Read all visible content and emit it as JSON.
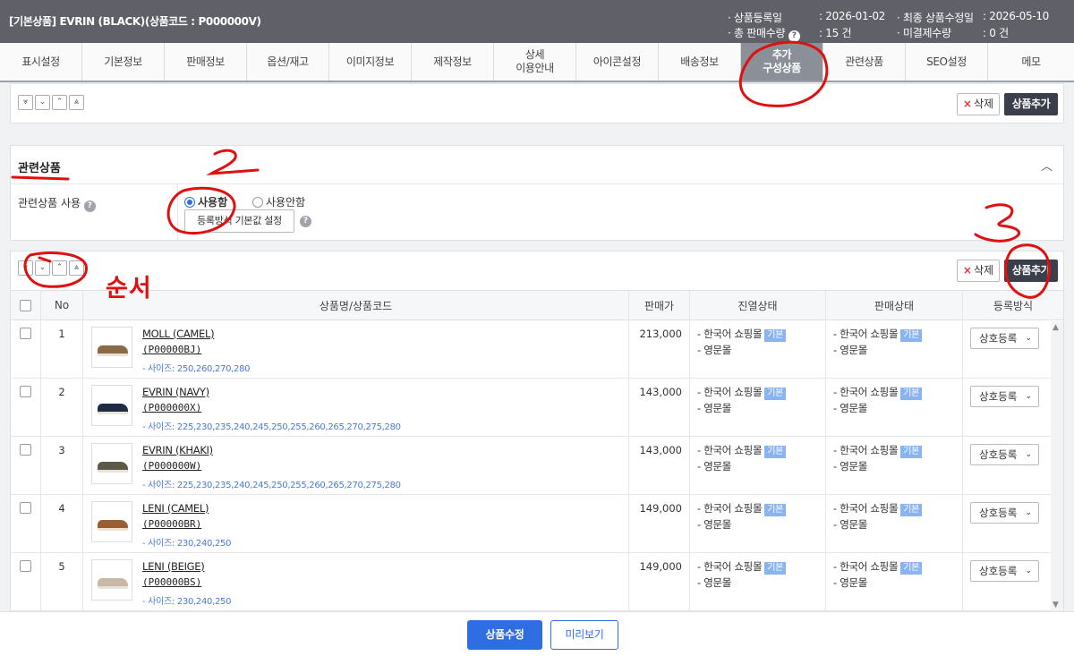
{
  "header": {
    "product_title": "[기본상품] EVRIN (BLACK)(상품코드 : P000000V)",
    "meta": [
      {
        "label": "· 상품등록일",
        "value": ": 2026-01-02"
      },
      {
        "label": "· 총 판매수량",
        "value": ": 15 건"
      },
      {
        "label": "· 최종 상품수정일",
        "value": ": 2026-05-10"
      },
      {
        "label": "· 미결제수량",
        "value": ": 0 건"
      }
    ]
  },
  "tabs": [
    {
      "label": "표시설정"
    },
    {
      "label": "기본정보"
    },
    {
      "label": "판매정보"
    },
    {
      "label": "옵션/재고"
    },
    {
      "label": "이미지정보"
    },
    {
      "label": "제작정보"
    },
    {
      "label": "상세\n이용안내"
    },
    {
      "label": "아이콘설정"
    },
    {
      "label": "배송정보"
    },
    {
      "label": "추가\n구성상품",
      "active": true
    },
    {
      "label": "관련상품"
    },
    {
      "label": "SEO설정"
    },
    {
      "label": "메모"
    }
  ],
  "top_panel": {
    "delete_label": "삭제",
    "add_label": "상품추가"
  },
  "related": {
    "section_title": "관련상품",
    "use_label": "관련상품 사용",
    "radio_use": "사용함",
    "radio_nouse": "사용안함",
    "default_btn": "등록방식 기본값 설정"
  },
  "list_panel": {
    "delete_label": "삭제",
    "add_label": "상품추가",
    "columns": [
      "",
      "No",
      "상품명/상품코드",
      "판매가",
      "진열상태",
      "판매상태",
      "등록방식"
    ],
    "rows": [
      {
        "no": "1",
        "name": "MOLL (CAMEL)",
        "code": "(P00000BJ)",
        "sizes": "- 사이즈: 250,260,270,280",
        "price": "213,000",
        "shoe_color": "#8a6a45"
      },
      {
        "no": "2",
        "name": "EVRIN (NAVY)",
        "code": "(P000000X)",
        "sizes": "- 사이즈: 225,230,235,240,245,250,255,260,265,270,275,280",
        "price": "143,000",
        "shoe_color": "#1f2a44"
      },
      {
        "no": "3",
        "name": "EVRIN (KHAKI)",
        "code": "(P000000W)",
        "sizes": "- 사이즈: 225,230,235,240,245,250,255,260,265,270,275,280",
        "price": "143,000",
        "shoe_color": "#5c5a45"
      },
      {
        "no": "4",
        "name": "LENI (CAMEL)",
        "code": "(P00000BR)",
        "sizes": "- 사이즈: 230,240,250",
        "price": "149,000",
        "shoe_color": "#9a5f30"
      },
      {
        "no": "5",
        "name": "LENI (BEIGE)",
        "code": "(P00000BS)",
        "sizes": "- 사이즈: 230,240,250",
        "price": "149,000",
        "shoe_color": "#c9b8a6"
      }
    ],
    "mall_kr": "- 한국어 쇼핑몰",
    "mall_en": "- 영문몰",
    "badge": "기본",
    "reg_method": "상호등록"
  },
  "annotations": {
    "order_text": "순서",
    "color": "#e01010"
  },
  "footer": {
    "save_label": "상품수정",
    "preview_label": "미리보기"
  }
}
